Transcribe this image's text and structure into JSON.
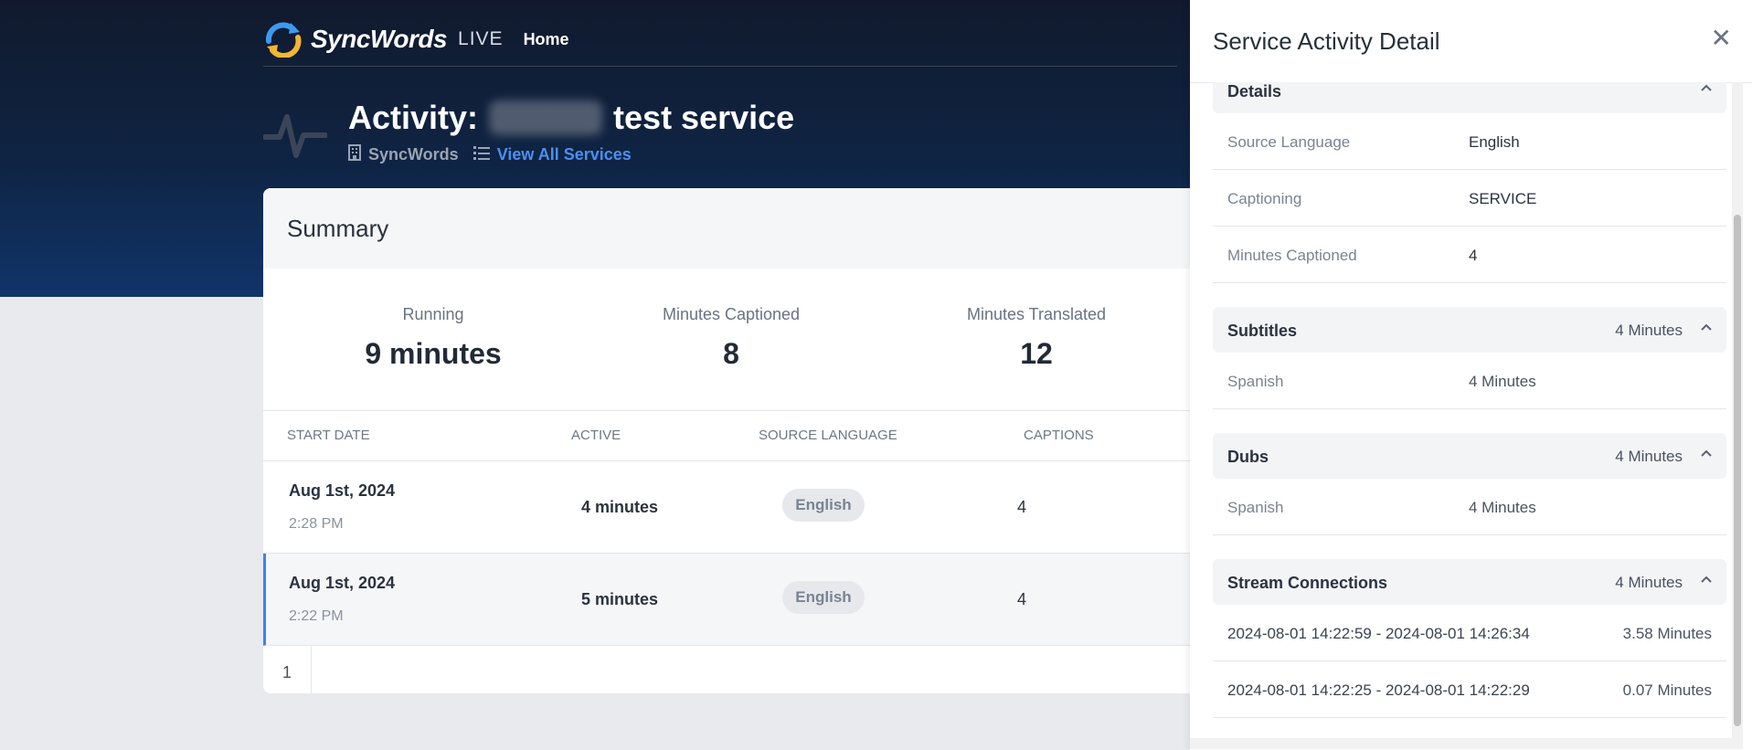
{
  "app": {
    "brand": "SyncWords",
    "brand_suffix": "LIVE",
    "nav_home": "Home"
  },
  "header": {
    "title_prefix": "Activity:",
    "title_suffix": "test service",
    "org_name": "SyncWords",
    "view_all_link": "View All Services"
  },
  "summary": {
    "title": "Summary",
    "stats": [
      {
        "label": "Running",
        "value": "9 minutes"
      },
      {
        "label": "Minutes Captioned",
        "value": "8"
      },
      {
        "label": "Minutes Translated",
        "value": "12"
      }
    ],
    "columns": [
      "START DATE",
      "ACTIVE",
      "SOURCE LANGUAGE",
      "CAPTIONS"
    ],
    "rows": [
      {
        "date": "Aug 1st, 2024",
        "time": "2:28 PM",
        "active": "4 minutes",
        "source_language": "English",
        "captions": "4"
      },
      {
        "date": "Aug 1st, 2024",
        "time": "2:22 PM",
        "active": "5 minutes",
        "source_language": "English",
        "captions": "4"
      }
    ],
    "pagination": {
      "current_page": "1"
    }
  },
  "drawer": {
    "title": "Service Activity Detail",
    "close_glyph": "✕",
    "details": {
      "heading": "Details",
      "rows": [
        {
          "key": "Source Language",
          "value": "English"
        },
        {
          "key": "Captioning",
          "value": "SERVICE"
        },
        {
          "key": "Minutes Captioned",
          "value": "4"
        }
      ]
    },
    "subtitles": {
      "heading": "Subtitles",
      "total": "4 Minutes",
      "rows": [
        {
          "key": "Spanish",
          "value": "4 Minutes"
        }
      ]
    },
    "dubs": {
      "heading": "Dubs",
      "total": "4 Minutes",
      "rows": [
        {
          "key": "Spanish",
          "value": "4 Minutes"
        }
      ]
    },
    "streams": {
      "heading": "Stream Connections",
      "total": "4 Minutes",
      "rows": [
        {
          "range": "2024-08-01 14:22:59 - 2024-08-01 14:26:34",
          "duration": "3.58 Minutes"
        },
        {
          "range": "2024-08-01 14:22:25 - 2024-08-01 14:22:29",
          "duration": "0.07 Minutes"
        }
      ]
    }
  },
  "colors": {
    "accent": "#3b82f6",
    "link": "#4a90f0",
    "hero_top": "#111a2d",
    "hero_bottom": "#10346a"
  }
}
